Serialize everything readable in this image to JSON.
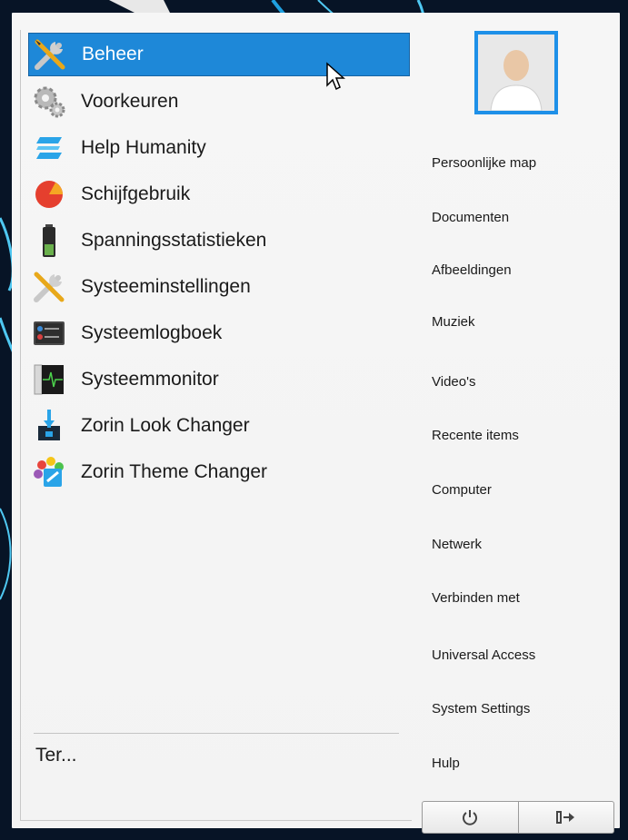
{
  "apps": [
    {
      "label": "Beheer",
      "icon": "admin-tools-icon",
      "selected": true
    },
    {
      "label": "Voorkeuren",
      "icon": "preferences-gears-icon"
    },
    {
      "label": "Help Humanity",
      "icon": "zorin-logo-icon"
    },
    {
      "label": "Schijfgebruik",
      "icon": "disk-usage-pie-icon"
    },
    {
      "label": "Spanningsstatistieken",
      "icon": "battery-icon"
    },
    {
      "label": "Systeeminstellingen",
      "icon": "system-settings-tools-icon"
    },
    {
      "label": "Systeemlogboek",
      "icon": "system-log-icon"
    },
    {
      "label": "Systeemmonitor",
      "icon": "system-monitor-icon"
    },
    {
      "label": "Zorin Look Changer",
      "icon": "zorin-look-changer-icon"
    },
    {
      "label": "Zorin Theme Changer",
      "icon": "zorin-theme-changer-icon"
    }
  ],
  "search": {
    "text": "Ter..."
  },
  "places": [
    "Persoonlijke map",
    "Documenten",
    "Afbeeldingen",
    "Muziek",
    "Video's",
    "Recente items",
    "Computer",
    "Netwerk",
    "Verbinden met",
    "Universal Access",
    "System Settings",
    "Hulp"
  ],
  "power": {
    "shutdown_icon": "power-icon",
    "logout_icon": "logout-arrow-icon"
  },
  "colors": {
    "selection": "#1e88d8",
    "avatar_border": "#1e90e8",
    "background": "#f4f4f4"
  }
}
